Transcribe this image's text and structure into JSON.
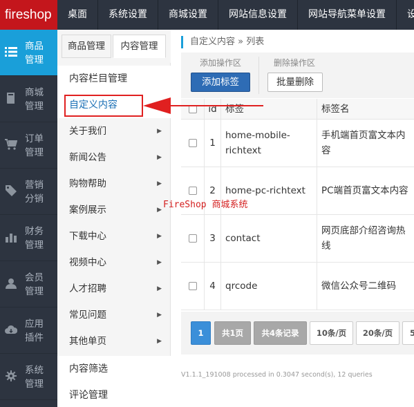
{
  "logo": "fireshop",
  "topnav": [
    "桌面",
    "系统设置",
    "商城设置",
    "网站信息设置",
    "网站导航菜单设置",
    "设"
  ],
  "sidebar": [
    {
      "icon": "list-icon",
      "label": "商品管理",
      "active": true
    },
    {
      "icon": "book-icon",
      "label": "商城管理"
    },
    {
      "icon": "cart-icon",
      "label": "订单管理"
    },
    {
      "icon": "tag-icon",
      "label": "营销分销"
    },
    {
      "icon": "bar-chart-icon",
      "label": "财务管理"
    },
    {
      "icon": "user-icon",
      "label": "会员管理"
    },
    {
      "icon": "cloud-icon",
      "label": "应用插件"
    },
    {
      "icon": "gear-icon",
      "label": "系统管理"
    }
  ],
  "tabs": {
    "goods": "商品管理",
    "content": "内容管理"
  },
  "menu": {
    "column_manage": "内容栏目管理",
    "custom_content": "自定义内容",
    "items": [
      "关于我们",
      "新闻公告",
      "购物帮助",
      "案例展示",
      "下载中心",
      "视频中心",
      "人才招聘",
      "常见问题",
      "其他单页"
    ],
    "filter": "内容筛选",
    "comments": "评论管理"
  },
  "breadcrumb": {
    "main": "自定义内容",
    "sep": " » ",
    "sub": "列表"
  },
  "ops": {
    "add_area": "添加操作区",
    "delete_area": "删除操作区",
    "add_button": "添加标签",
    "batch_delete_button": "批量删除"
  },
  "table": {
    "headers": {
      "id": "id",
      "tag": "标签",
      "tag_name": "标签名"
    },
    "rows": [
      {
        "id": "1",
        "tag": "home-mobile-richtext",
        "name": "手机端首页富文本内容"
      },
      {
        "id": "2",
        "tag": "home-pc-richtext",
        "name": "PC端首页富文本内容"
      },
      {
        "id": "3",
        "tag": "contact",
        "name": "网页底部介绍咨询热线"
      },
      {
        "id": "4",
        "tag": "qrcode",
        "name": "微信公众号二维码"
      }
    ]
  },
  "pager": {
    "current": "1",
    "total_pages": "共1页",
    "total_records": "共4条记录",
    "per10": "10条/页",
    "per20": "20条/页",
    "per_more": "5"
  },
  "footer": "V1.1.1_191008 processed in 0.3047 second(s), 12 queries",
  "watermark": "FireShop 商城系统",
  "colors": {
    "brand": "#c4161c",
    "accent": "#1a9fd9",
    "primary_button": "#2e6cb5",
    "highlight_box": "#e02020"
  }
}
